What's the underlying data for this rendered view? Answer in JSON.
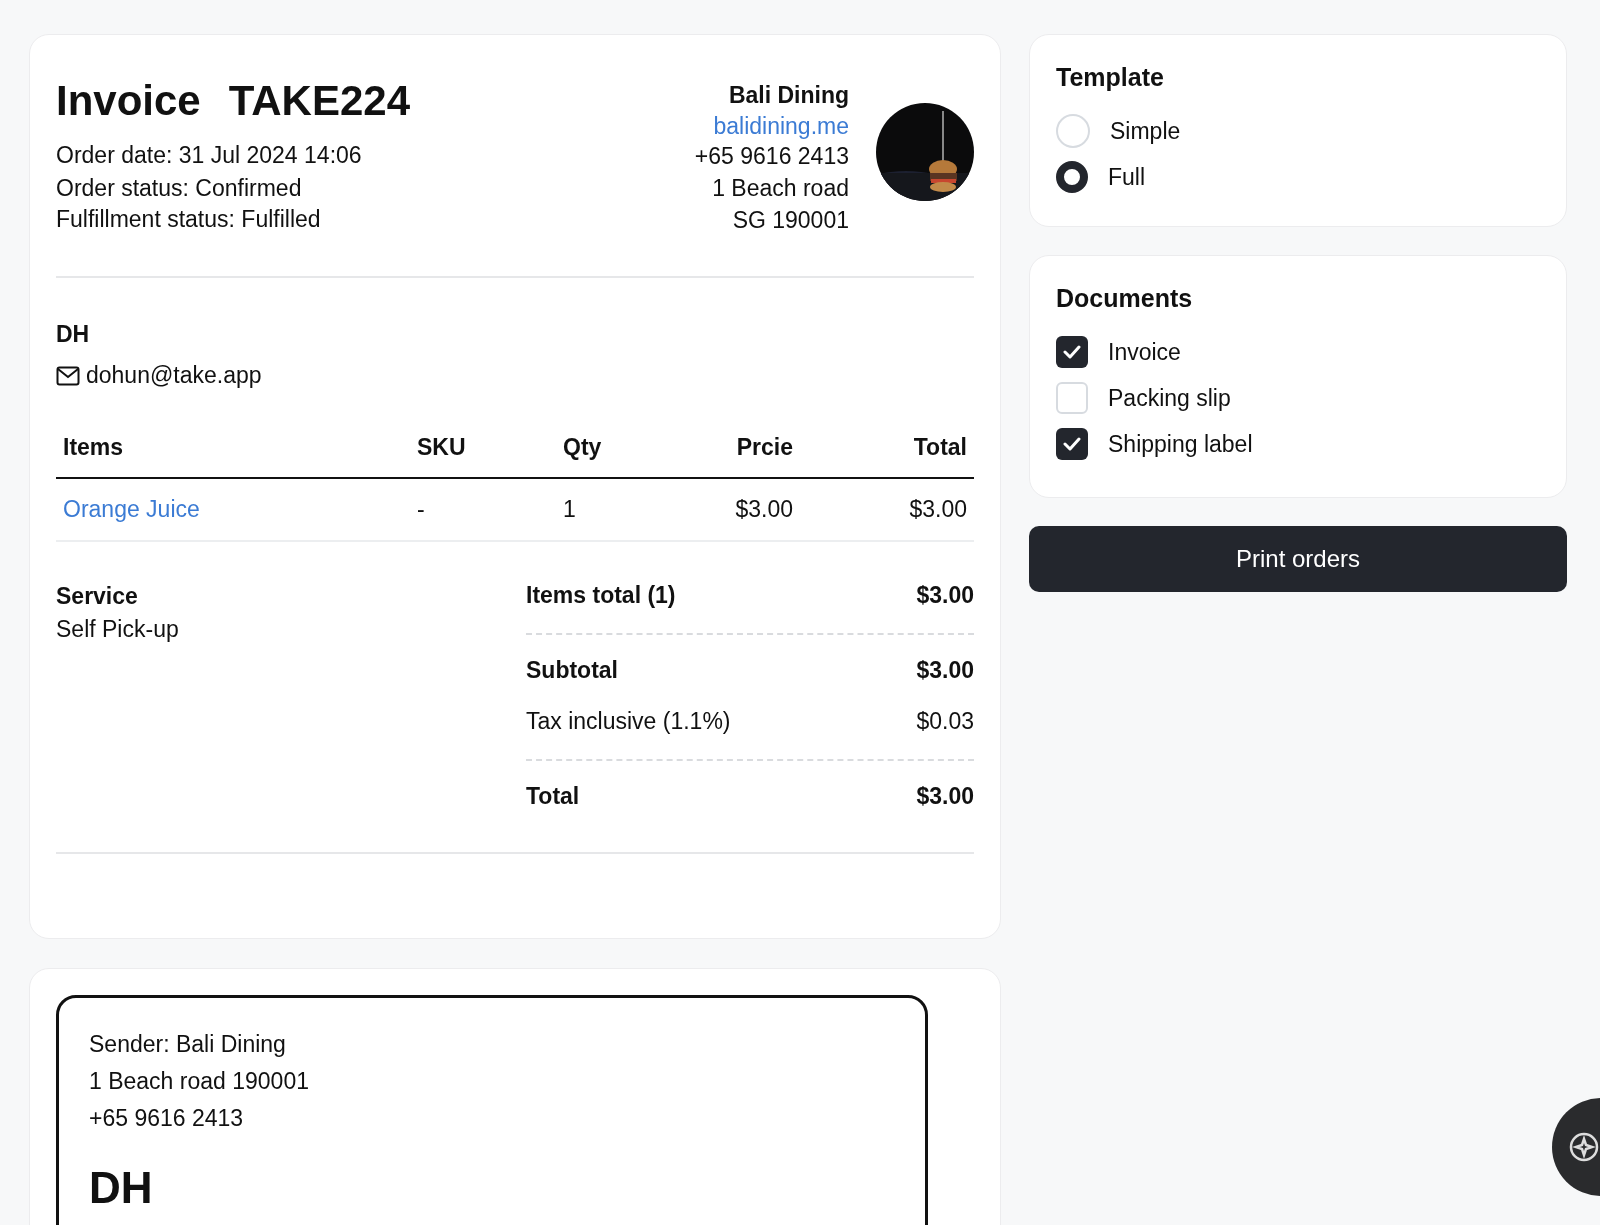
{
  "invoice": {
    "title": "Invoice",
    "number": "TAKE224",
    "details": [
      "Order date: 31 Jul 2024 14:06",
      "Order status: Confirmed",
      "Fulfillment status: Fulfilled"
    ],
    "business": {
      "name": "Bali Dining",
      "website": "balidining.me",
      "lines": [
        "+65 9616 2413",
        "1 Beach road",
        "SG 190001"
      ]
    },
    "customer": {
      "name": "DH",
      "email": "dohun@take.app"
    },
    "table": {
      "columns": [
        "Items",
        "SKU",
        "Qty",
        "Prcie",
        "Total"
      ],
      "rows": [
        [
          "Orange Juice",
          "-",
          "1",
          "$3.00",
          "$3.00"
        ]
      ]
    },
    "service": {
      "label": "Service",
      "value": "Self Pick-up"
    },
    "summary": [
      {
        "kind": "row",
        "label": "Items total (1)",
        "value": "$3.00",
        "bold": true
      },
      {
        "kind": "divider"
      },
      {
        "kind": "row",
        "label": "Subtotal",
        "value": "$3.00",
        "bold": true
      },
      {
        "kind": "row",
        "label": "Tax inclusive (1.1%)",
        "value": "$0.03",
        "bold": false
      },
      {
        "kind": "divider"
      },
      {
        "kind": "row",
        "label": "Total",
        "value": "$3.00",
        "bold": true
      }
    ]
  },
  "shipping_label": {
    "lines": [
      "Sender: Bali Dining",
      "1 Beach road 190001",
      "+65 9616 2413"
    ],
    "recipient": "DH"
  },
  "template": {
    "title": "Template",
    "options": [
      {
        "label": "Simple",
        "selected": false
      },
      {
        "label": "Full",
        "selected": true
      }
    ]
  },
  "documents": {
    "title": "Documents",
    "options": [
      {
        "label": "Invoice",
        "checked": true
      },
      {
        "label": "Packing slip",
        "checked": false
      },
      {
        "label": "Shipping label",
        "checked": true
      }
    ]
  },
  "print_button": "Print orders"
}
